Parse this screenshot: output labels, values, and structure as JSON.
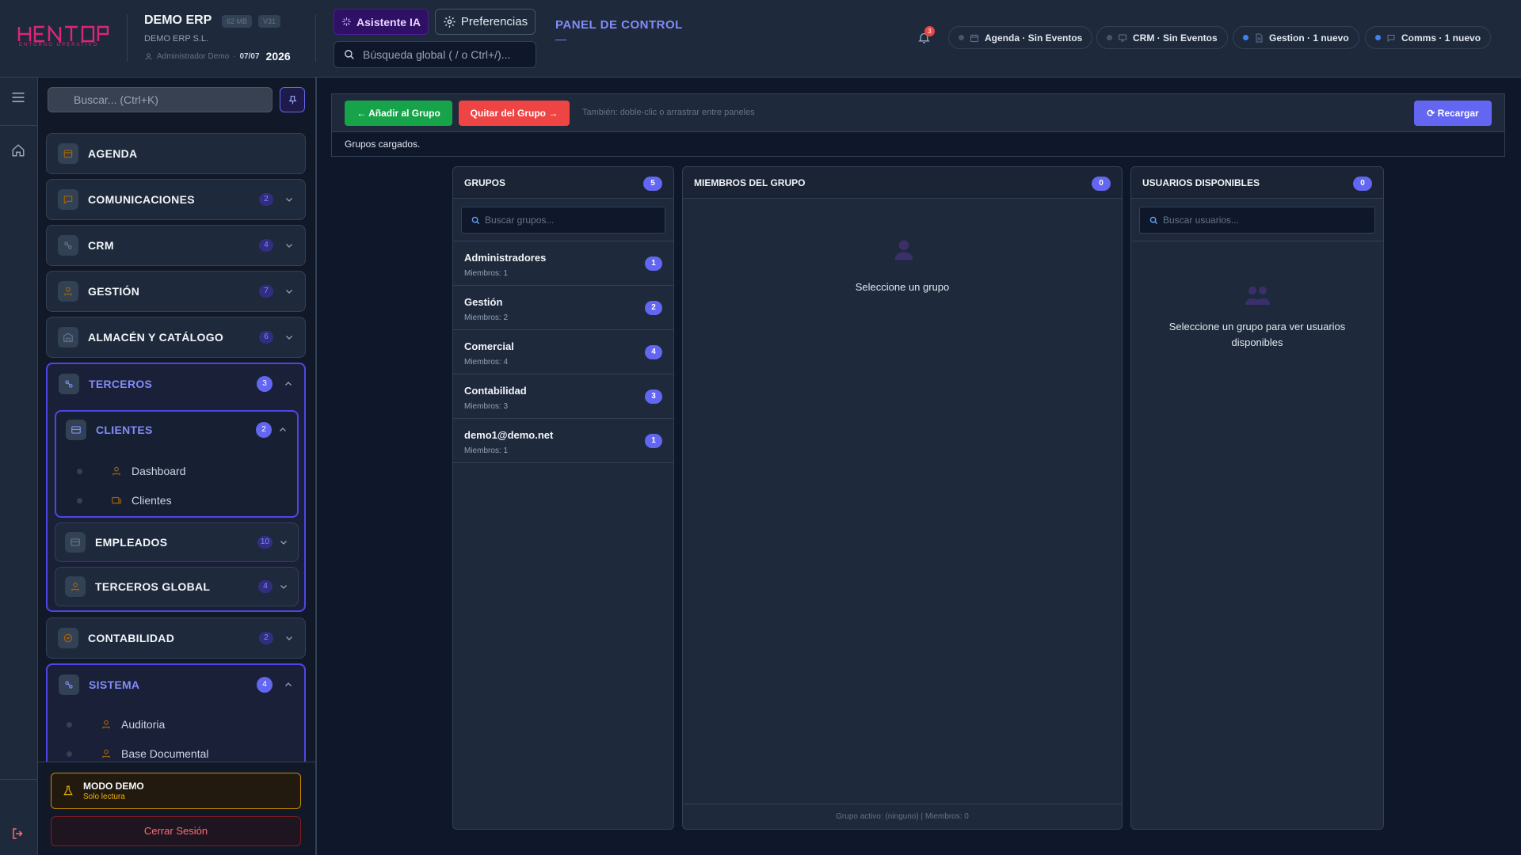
{
  "header": {
    "logo_text": "HENTOP",
    "logo_sub": "ENTORNO OPERATIVO",
    "app_name": "DEMO ERP",
    "size_chip": "62 MB",
    "version_chip": "V31",
    "company": "DEMO ERP S.L.",
    "user": "Administrador Demo",
    "separator": "·",
    "date": "07/07",
    "year": "2026",
    "ai_label": "Asistente IA",
    "prefs_label": "Preferencias",
    "search_placeholder": "Búsqueda global ( / o Ctrl+/)...",
    "panel_title": "PANEL DE CONTROL",
    "panel_sub": "—",
    "notif_count": "3",
    "pills": [
      {
        "label": "Agenda · Sin Eventos",
        "dot": "#475569",
        "icon": "calendar-icon"
      },
      {
        "label": "CRM · Sin Eventos",
        "dot": "#475569",
        "icon": "monitor-icon"
      },
      {
        "label": "Gestion · 1 nuevo",
        "dot": "#3b82f6",
        "icon": "document-icon"
      },
      {
        "label": "Comms · 1 nuevo",
        "dot": "#3b82f6",
        "icon": "chat-icon"
      }
    ]
  },
  "sidebar": {
    "search_placeholder": "Buscar... (Ctrl+K)",
    "groups": {
      "agenda": {
        "label": "AGENDA"
      },
      "comunicaciones": {
        "label": "COMUNICACIONES",
        "count": "2"
      },
      "crm": {
        "label": "CRM",
        "count": "4"
      },
      "gestion": {
        "label": "GESTIÓN",
        "count": "7"
      },
      "almacen": {
        "label": "ALMACÉN Y CATÁLOGO",
        "count": "6"
      },
      "terceros": {
        "label": "TERCEROS",
        "count": "3"
      },
      "contabilidad": {
        "label": "CONTABILIDAD",
        "count": "2"
      },
      "sistema": {
        "label": "SISTEMA",
        "count": "4"
      }
    },
    "terceros_sub": {
      "clientes": {
        "label": "CLIENTES",
        "count": "2",
        "items": [
          "Dashboard",
          "Clientes"
        ]
      },
      "empleados": {
        "label": "EMPLEADOS",
        "count": "10"
      },
      "terceros_global": {
        "label": "TERCEROS GLOBAL",
        "count": "4"
      }
    },
    "sistema_items": [
      "Auditoria",
      "Base Documental"
    ],
    "demo_title": "MODO DEMO",
    "demo_sub": "Solo lectura",
    "logout": "Cerrar Sesión"
  },
  "toolbar": {
    "add": "← Añadir al Grupo",
    "remove": "Quitar del Grupo →",
    "hint": "También: doble-clic o arrastrar entre paneles",
    "reload": "⟳ Recargar",
    "status": "Grupos cargados."
  },
  "groups_panel": {
    "title": "GRUPOS",
    "count": "5",
    "search_placeholder": "Buscar grupos...",
    "items": [
      {
        "name": "Administradores",
        "members": "Miembros: 1",
        "count": "1"
      },
      {
        "name": "Gestión",
        "members": "Miembros: 2",
        "count": "2"
      },
      {
        "name": "Comercial",
        "members": "Miembros: 4",
        "count": "4"
      },
      {
        "name": "Contabilidad",
        "members": "Miembros: 3",
        "count": "3"
      },
      {
        "name": "demo1@demo.net",
        "members": "Miembros: 1",
        "count": "1"
      }
    ]
  },
  "members_panel": {
    "title": "MIEMBROS DEL GRUPO",
    "count": "0",
    "empty": "Seleccione un grupo",
    "footer": "Grupo activo: (ninguno) | Miembros: 0"
  },
  "users_panel": {
    "title": "USUARIOS DISPONIBLES",
    "count": "0",
    "search_placeholder": "Buscar usuarios...",
    "empty": "Seleccione un grupo para ver usuarios disponibles"
  },
  "colors": {
    "accent": "#6366f1",
    "success": "#16a34a",
    "danger": "#ef4444",
    "brand": "#db2777",
    "warning": "#eab308"
  }
}
